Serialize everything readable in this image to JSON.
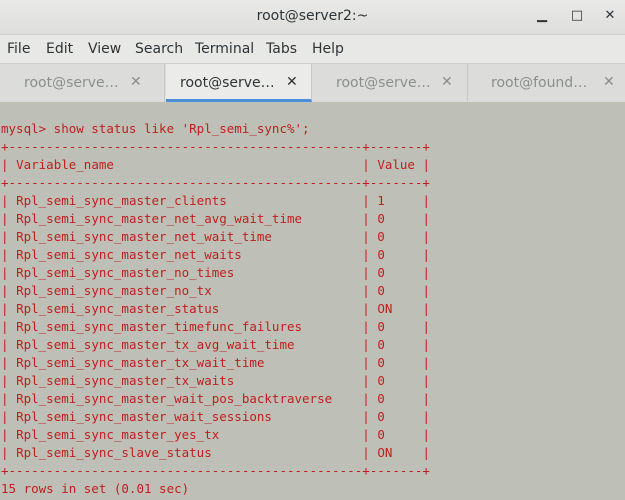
{
  "window": {
    "title": "root@server2:~"
  },
  "menu": [
    "File",
    "Edit",
    "View",
    "Search",
    "Terminal",
    "Tabs",
    "Help"
  ],
  "tabs": [
    {
      "label": "root@serve…",
      "active": false
    },
    {
      "label": "root@serve…",
      "active": true
    },
    {
      "label": "root@serve…",
      "active": false
    },
    {
      "label": "root@found…",
      "active": false
    }
  ],
  "terminal": {
    "command": "mysql> show status like 'Rpl_semi_sync%';",
    "header": {
      "name": "Variable_name",
      "value": "Value"
    },
    "rows": [
      {
        "name": "Rpl_semi_sync_master_clients",
        "value": "1"
      },
      {
        "name": "Rpl_semi_sync_master_net_avg_wait_time",
        "value": "0"
      },
      {
        "name": "Rpl_semi_sync_master_net_wait_time",
        "value": "0"
      },
      {
        "name": "Rpl_semi_sync_master_net_waits",
        "value": "0"
      },
      {
        "name": "Rpl_semi_sync_master_no_times",
        "value": "0"
      },
      {
        "name": "Rpl_semi_sync_master_no_tx",
        "value": "0"
      },
      {
        "name": "Rpl_semi_sync_master_status",
        "value": "ON"
      },
      {
        "name": "Rpl_semi_sync_master_timefunc_failures",
        "value": "0"
      },
      {
        "name": "Rpl_semi_sync_master_tx_avg_wait_time",
        "value": "0"
      },
      {
        "name": "Rpl_semi_sync_master_tx_wait_time",
        "value": "0"
      },
      {
        "name": "Rpl_semi_sync_master_tx_waits",
        "value": "0"
      },
      {
        "name": "Rpl_semi_sync_master_wait_pos_backtraverse",
        "value": "0"
      },
      {
        "name": "Rpl_semi_sync_master_wait_sessions",
        "value": "0"
      },
      {
        "name": "Rpl_semi_sync_master_yes_tx",
        "value": "0"
      },
      {
        "name": "Rpl_semi_sync_slave_status",
        "value": "ON"
      }
    ],
    "footer": "15 rows in set (0.01 sec)",
    "colors": {
      "background": "#bebfb6",
      "text": "#c01f1f"
    }
  }
}
